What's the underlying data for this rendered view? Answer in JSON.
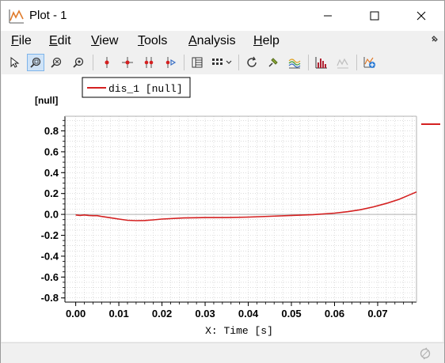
{
  "window": {
    "title": "Plot - 1"
  },
  "menu": [
    {
      "first": "F",
      "rest": "ile"
    },
    {
      "first": "E",
      "rest": "dit"
    },
    {
      "first": "V",
      "rest": "iew"
    },
    {
      "first": "T",
      "rest": "ools"
    },
    {
      "first": "A",
      "rest": "nalysis"
    },
    {
      "first": "H",
      "rest": "elp"
    }
  ],
  "toolbar_icons": [
    "pointer-icon",
    "zoom-region-icon",
    "zoom-out-icon",
    "zoom-fit-icon",
    "marker-icon",
    "crosshair-icon",
    "two-markers-icon",
    "marker-play-icon",
    "table-icon",
    "grid-layout-icon",
    "refresh-icon",
    "pin-icon",
    "curves-icon",
    "bar-histogram-icon",
    "curve-disabled-icon",
    "add-plot-icon"
  ],
  "colors": {
    "curve": "#d42020",
    "grid": "#c8c8c8",
    "axis": "#000000"
  },
  "chart_data": {
    "type": "line",
    "title": "",
    "xlabel": "X: Time [s]",
    "ylabel": "[null]",
    "xlim": [
      -0.0025,
      0.079
    ],
    "ylim": [
      -0.84,
      0.94
    ],
    "x_ticks": [
      0.0,
      0.01,
      0.02,
      0.03,
      0.04,
      0.05,
      0.06,
      0.07
    ],
    "x_tick_labels": [
      "0.00",
      "0.01",
      "0.02",
      "0.03",
      "0.04",
      "0.05",
      "0.06",
      "0.07"
    ],
    "y_ticks": [
      0.8,
      0.6,
      0.4,
      0.2,
      0.0,
      -0.2,
      -0.4,
      -0.6,
      -0.8
    ],
    "y_tick_labels": [
      "0.8",
      "0.6",
      "0.4",
      "0.2",
      "0.0",
      "-0.2",
      "-0.4",
      "-0.6",
      "-0.8"
    ],
    "grid": true,
    "legend_position": "top-left",
    "series": [
      {
        "name": "dis_1 [null]",
        "x": [
          0.0,
          0.001,
          0.002,
          0.003,
          0.004,
          0.005,
          0.006,
          0.008,
          0.01,
          0.012,
          0.014,
          0.016,
          0.018,
          0.02,
          0.025,
          0.03,
          0.035,
          0.04,
          0.045,
          0.05,
          0.055,
          0.06,
          0.063,
          0.066,
          0.069,
          0.072,
          0.075,
          0.077,
          0.079
        ],
        "y": [
          -0.005,
          -0.01,
          -0.005,
          -0.01,
          -0.012,
          -0.012,
          -0.02,
          -0.032,
          -0.045,
          -0.056,
          -0.06,
          -0.058,
          -0.052,
          -0.045,
          -0.034,
          -0.03,
          -0.03,
          -0.026,
          -0.018,
          -0.01,
          -0.002,
          0.012,
          0.026,
          0.045,
          0.072,
          0.105,
          0.145,
          0.18,
          0.215
        ]
      }
    ]
  }
}
